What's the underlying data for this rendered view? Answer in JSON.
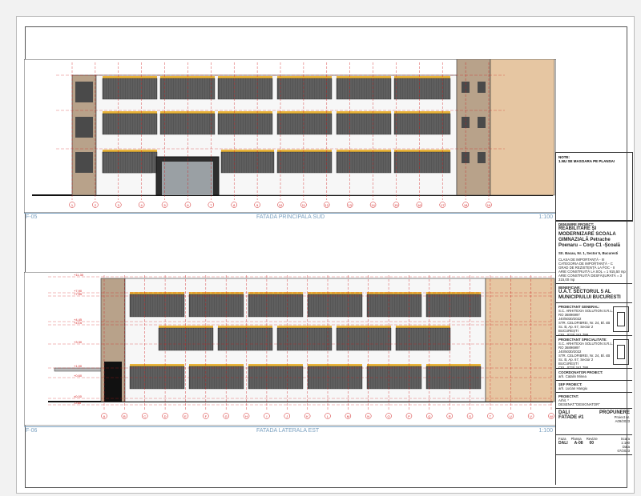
{
  "views": {
    "top": {
      "id": "F-05",
      "title": "FATADA PRINCIPALA SUD",
      "scale": "1:100"
    },
    "bottom": {
      "id": "F-06",
      "title": "FATADA LATERALA EST",
      "scale": "1:100"
    }
  },
  "notes": {
    "label": "NOTE:",
    "text": "1.NU SE MASOARA PE PLANSA!"
  },
  "project": {
    "label": "DENUMIRE PROIECT:",
    "title": "REABILITARE ȘI MODERNIZARE SCOALA GIMNAZIALĂ Petrache Poenaru – Corp C1 -Școală",
    "address": "Str. Bacau, Nr. 1, Sector 5, Bucuresti",
    "details": [
      "CLASA DE IMPORTANȚĂ - III",
      "CATEGORIA DE IMPORTANȚĂ - C",
      "GRAD DE REZISTENȚĂ LA FOC - II",
      "ARIE CONSTRUITĂ LA SOL = 1 915,50 mp",
      "ARIE CONSTRUITĂ DESFĂȘURATĂ = 3 315,00 mp"
    ]
  },
  "beneficiary": {
    "label": "BENEFICIAR:",
    "name": "U.A.T. SECTORUL 5 AL MUNICIPIULUI BUCURESTI"
  },
  "general_designer": {
    "label": "PROIECTANT GENERAL:",
    "lines": [
      "S.C. ARHITEXIA SOLUTION S.R.L.",
      "RO 36896997",
      "J40/5030/2022",
      "STR. CELOFIBREI, Nr. 24, Bl. 4B",
      "Sc. B, Ap. 67, Sector 2",
      "BUCUREȘTI",
      "CEL. 0720.241.788"
    ]
  },
  "specialty_designer": {
    "label": "PROIECTANT SPECIALITATE:",
    "lines": [
      "S.C. ARHITEXIA SOLUTION S.R.L.",
      "RO 36896997",
      "J40/5030/2022",
      "STR. CELOFIBREI, Nr. 24, Bl. 4B",
      "Sc. B, Ap. 67, Sector 2",
      "BUCUREȘTI",
      "CEL. 0720.241.788"
    ]
  },
  "coordinator": {
    "label": "COORDONATOR PROIECT:",
    "name": "arh. Catalin Minea"
  },
  "chief": {
    "label": "ȘEF PROIECT:",
    "name": "arh. Lucian Hangiu"
  },
  "designed": {
    "label": "PROIECTAT:",
    "name": "Arhit. *"
  },
  "drawn": {
    "label": "",
    "name": "DESENAT:\"DESIGNATOR\""
  },
  "phase": {
    "code": "DALI",
    "stage": "PROPUNERE",
    "sheet_title": "FATADE #1",
    "project_no_label": "Proiect nr.",
    "project_no": "A09/2023"
  },
  "footer": {
    "headers": [
      "Faza",
      "Planșa",
      "Revizie"
    ],
    "values": [
      "DALI",
      "A-08",
      "00"
    ],
    "scale_label": "Scara",
    "scale": "1:100",
    "date_label": "Data",
    "date": "07/2023"
  },
  "axes_top": [
    "1",
    "2",
    "3",
    "4",
    "5",
    "6",
    "7",
    "8",
    "9",
    "10",
    "11",
    "12",
    "13",
    "14",
    "15",
    "16",
    "17",
    "18",
    "19"
  ],
  "axes_bottom": [
    "A",
    "B",
    "C",
    "D",
    "E",
    "F",
    "G",
    "H",
    "I",
    "J",
    "K",
    "L",
    "M",
    "N",
    "O",
    "P",
    "Q",
    "R",
    "S",
    "T",
    "U",
    "V",
    "W"
  ],
  "levels": [
    "+11.30",
    "+7.90",
    "+7.55",
    "+4.45",
    "+4.15",
    "+3.30",
    "+1.00",
    "+0.60",
    "±0.00",
    "-0.60"
  ],
  "colors": {
    "brick": "#e6c6a2",
    "yellow": "#e9b43a",
    "dark": "#3c3c3c",
    "red": "#d11a1a",
    "accent": "#7aa0c0"
  }
}
